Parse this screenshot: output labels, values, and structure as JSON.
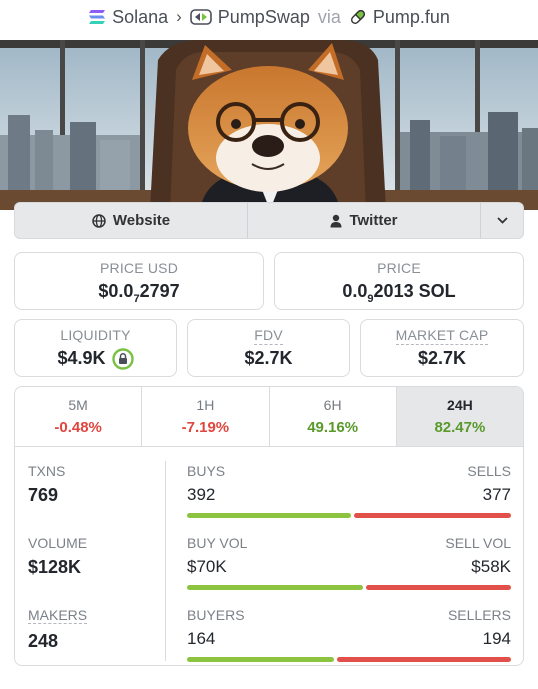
{
  "breadcrumb": {
    "chain": "Solana",
    "dex": "PumpSwap",
    "via": "via",
    "source": "Pump.fun"
  },
  "links": {
    "website": "Website",
    "twitter": "Twitter"
  },
  "prices": {
    "usd_label": "PRICE USD",
    "usd_prefix": "$0.0",
    "usd_zeros": "7",
    "usd_digits": "2797",
    "sol_label": "PRICE",
    "sol_prefix": "0.0",
    "sol_zeros": "9",
    "sol_digits": "2013 SOL"
  },
  "metrics": {
    "liquidity_label": "LIQUIDITY",
    "liquidity_value": "$4.9K",
    "fdv_label": "FDV",
    "fdv_value": "$2.7K",
    "mcap_label": "MARKET CAP",
    "mcap_value": "$2.7K"
  },
  "tabs": [
    {
      "label": "5M",
      "change": "-0.48%"
    },
    {
      "label": "1H",
      "change": "-7.19%"
    },
    {
      "label": "6H",
      "change": "49.16%"
    },
    {
      "label": "24H",
      "change": "82.47%"
    }
  ],
  "stats": {
    "txns_label": "TXNS",
    "txns_value": "769",
    "buys_label": "BUYS",
    "buys_value": "392",
    "sells_label": "SELLS",
    "sells_value": "377",
    "volume_label": "VOLUME",
    "volume_value": "$128K",
    "buyvol_label": "BUY VOL",
    "buyvol_value": "$70K",
    "sellvol_label": "SELL VOL",
    "sellvol_value": "$58K",
    "makers_label": "MAKERS",
    "makers_value": "248",
    "buyers_label": "BUYERS",
    "buyers_value": "164",
    "sellers_label": "SELLERS",
    "sellers_value": "194"
  },
  "ratios": {
    "buys_share": 0.51,
    "buyvol_share": 0.547,
    "buyers_share": 0.458
  },
  "colors": {
    "positive": "#5a9a2b",
    "negative": "#e0463f",
    "bar_green": "#8cc43f",
    "bar_red": "#e2504a"
  }
}
